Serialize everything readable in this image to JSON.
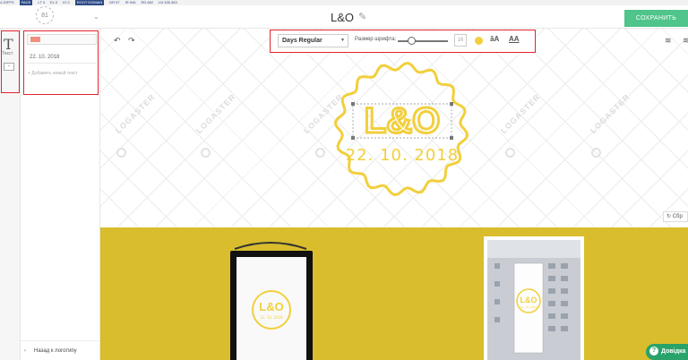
{
  "devbar": {
    "items": [
      "4.20FPS",
      "PAGE",
      "LT 0",
      "EL 0",
      "IO 0",
      "ROOT DOMAIN",
      "DR 57",
      "IR 946",
      "RD 682",
      "LN 326,363"
    ]
  },
  "header": {
    "logo_badge": "81",
    "title": "L&O",
    "save_label": "СОХРАНИТЬ"
  },
  "rail": {
    "text_tool_label": "Текст"
  },
  "panel": {
    "field2_value": "22. 10. 2018",
    "add_text": "+ Добавить новый текст",
    "back_label": "Назад к логотипу"
  },
  "toolbar": {
    "font_name": "Days Regular",
    "size_label": "Размер шрифта:",
    "size_value": "16",
    "case_a": "āA",
    "case_b": "AA",
    "font_color": "#f2cf3c"
  },
  "canvas": {
    "watermark": "LOGASTER",
    "reset_label": "Сбр",
    "logo_title": "L&O",
    "logo_date": "22. 10. 2018",
    "logo_color": "#f2cf3c"
  },
  "mockups": {
    "poster_title": "L&O",
    "poster_date": "22. 10. 2018",
    "banner_title": "L&O",
    "banner_date": "22. 10. 2018"
  },
  "help": {
    "label": "Довідка"
  },
  "colors": {
    "accent_green": "#4fc48b",
    "highlight_red": "#e3232f",
    "mockup_yellow": "#d9bd2c"
  }
}
